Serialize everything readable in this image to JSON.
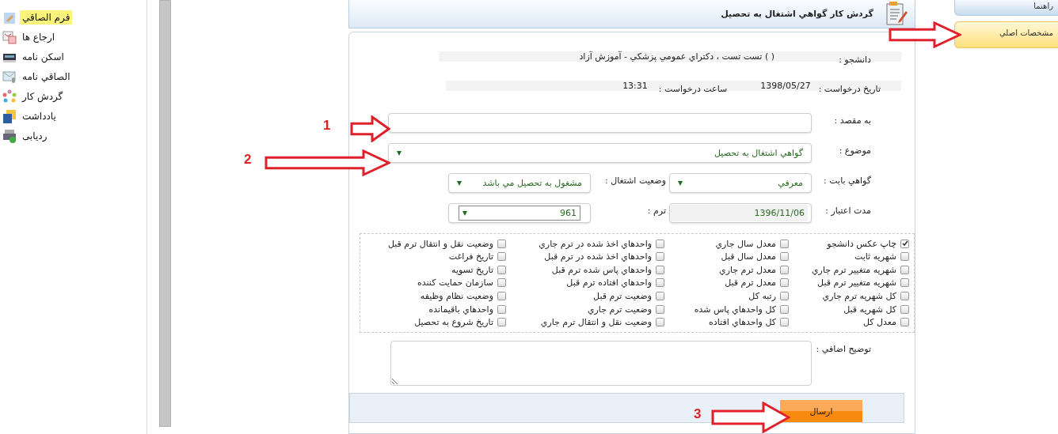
{
  "sidebar": {
    "items": [
      {
        "label": "فرم الصاقي",
        "selected": true
      },
      {
        "label": "ارجاع ها",
        "selected": false
      },
      {
        "label": "اسکن نامه",
        "selected": false
      },
      {
        "label": "الصاقي نامه",
        "selected": false
      },
      {
        "label": "گردش کار",
        "selected": false
      },
      {
        "label": "يادداشت",
        "selected": false
      },
      {
        "label": "ردیابی",
        "selected": false
      }
    ]
  },
  "header": {
    "title": "گردش کار گواهي اشتغال به تحصيل"
  },
  "tabs": [
    {
      "label": "راهنما",
      "selected": false
    },
    {
      "label": "مشخصات اصلي",
      "selected": true
    }
  ],
  "form": {
    "student": {
      "label": "دانشجو :",
      "value": "(        ) تست تست          ، دکتراي عمومي پزشکي - آموزش آزاد"
    },
    "request_date": {
      "label": "تاريخ درخواست :",
      "value": "1398/05/27"
    },
    "request_time": {
      "label": "ساعت درخواست :",
      "value": "13:31"
    },
    "rows": [
      [
        {
          "kind": "input",
          "label": "به مقصد :"
        }
      ],
      [
        {
          "kind": "select",
          "label": "موضوع :",
          "value": "گواهي اشتغال به تحصيل"
        }
      ],
      [
        {
          "kind": "select",
          "label": "گواهي بابت :",
          "value": "معرفي"
        },
        {
          "kind": "select",
          "label": "وضعيت اشتغال :",
          "value": "مشغول به تحصيل مي باشد"
        }
      ],
      [
        {
          "kind": "readonly",
          "label": "مدت اعتبار :",
          "value": "1396/11/06"
        },
        {
          "kind": "boxed-select",
          "label": "ترم :",
          "value": "961"
        }
      ]
    ],
    "checkboxes": [
      {
        "label": "چاپ عکس دانشجو",
        "checked": true
      },
      {
        "label": "معدل سال جاري",
        "checked": false
      },
      {
        "label": "واحدهاي اخذ شده در ترم جاري",
        "checked": false
      },
      {
        "label": "وضعيت نقل و انتقال ترم قبل",
        "checked": false
      },
      {
        "label": "شهريه ثابت",
        "checked": false
      },
      {
        "label": "معدل سال قبل",
        "checked": false
      },
      {
        "label": "واحدهاي اخذ شده در ترم قبل",
        "checked": false
      },
      {
        "label": "تاريخ فراغت",
        "checked": false
      },
      {
        "label": "شهريه متغيير ترم جاري",
        "checked": false
      },
      {
        "label": "معدل ترم جاري",
        "checked": false
      },
      {
        "label": "واحدهاي پاس شده ترم قبل",
        "checked": false
      },
      {
        "label": "تاريخ تسويه",
        "checked": false
      },
      {
        "label": "شهريه متغيير ترم قبل",
        "checked": false
      },
      {
        "label": "معدل ترم قبل",
        "checked": false
      },
      {
        "label": "واحدهاي افتاده ترم قبل",
        "checked": false
      },
      {
        "label": "سازمان حمايت کننده",
        "checked": false
      },
      {
        "label": "کل شهريه ترم جاري",
        "checked": false
      },
      {
        "label": "رتبه کل",
        "checked": false
      },
      {
        "label": "وضعيت ترم قبل",
        "checked": false
      },
      {
        "label": "وضعيت نظام وظيفه",
        "checked": false
      },
      {
        "label": "کل شهريه قبل",
        "checked": false
      },
      {
        "label": "کل واحدهاي پاس شده",
        "checked": false
      },
      {
        "label": "وضعيت ترم جاري",
        "checked": false
      },
      {
        "label": "واحدهاي باقيمانده",
        "checked": false
      },
      {
        "label": "معدل کل",
        "checked": false
      },
      {
        "label": "کل واحدهاي افتاده",
        "checked": false
      },
      {
        "label": "وضعيت نقل و انتقال ترم جاري",
        "checked": false
      },
      {
        "label": "تاريخ شروع به تحصيل",
        "checked": false
      }
    ],
    "note": {
      "label": "توضيح اضافي :"
    },
    "submit": {
      "label": "ارسال"
    }
  },
  "annotations": [
    {
      "kind": "arrow"
    },
    {
      "kind": "numbered",
      "number": "1"
    },
    {
      "kind": "numbered",
      "number": "2"
    },
    {
      "kind": "numbered",
      "number": "3"
    }
  ]
}
